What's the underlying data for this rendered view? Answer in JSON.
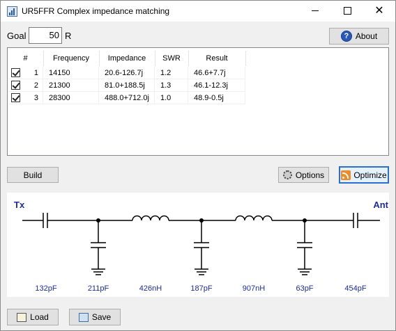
{
  "window": {
    "title": "UR5FFR Complex impedance matching"
  },
  "goal": {
    "label": "Goal",
    "value": "50",
    "unit": "R"
  },
  "about_label": "About",
  "table": {
    "headers": [
      "#",
      "Frequency",
      "Impedance",
      "SWR",
      "Result"
    ],
    "rows": [
      {
        "checked": true,
        "num": "1",
        "freq": "14150",
        "imp": "20.6-126.7j",
        "swr": "1.2",
        "result": "46.6+7.7j"
      },
      {
        "checked": true,
        "num": "2",
        "freq": "21300",
        "imp": "81.0+188.5j",
        "swr": "1.3",
        "result": "46.1-12.3j"
      },
      {
        "checked": true,
        "num": "3",
        "freq": "28300",
        "imp": "488.0+712.0j",
        "swr": "1.0",
        "result": "48.9-0.5j"
      }
    ]
  },
  "buttons": {
    "build": "Build",
    "options": "Options",
    "optimize": "Optimize",
    "load": "Load",
    "save": "Save"
  },
  "schematic": {
    "tx_label": "Tx",
    "ant_label": "Ant",
    "components": [
      "132pF",
      "211pF",
      "426nH",
      "187pF",
      "907nH",
      "63pF",
      "454pF"
    ],
    "label_color": "#1a2aa8"
  }
}
